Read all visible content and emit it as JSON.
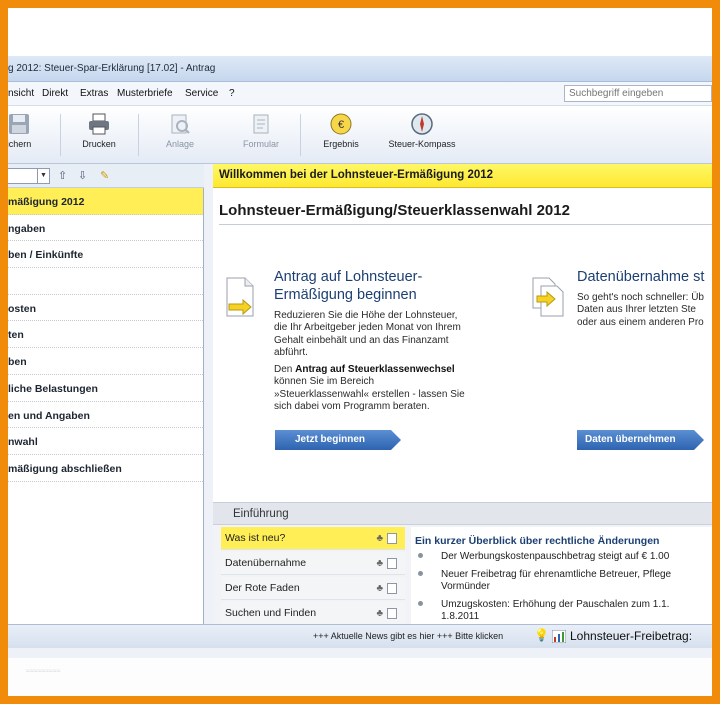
{
  "window": {
    "title": "g 2012: Steuer-Spar-Erklärung [17.02] - Antrag"
  },
  "menu": {
    "items": [
      "nsicht",
      "Direkt",
      "Extras",
      "Musterbriefe",
      "Service",
      "?"
    ],
    "search_placeholder": "Suchbegriff eingeben"
  },
  "toolbar": {
    "save_label": "ichern",
    "print_label": "Drucken",
    "attach_label": "Anlage",
    "form_label": "Formular",
    "result_label": "Ergebnis",
    "compass_label": "Steuer-Kompass"
  },
  "sidebar": {
    "items": [
      "mäßigung 2012",
      "ngaben",
      "ben / Einkünfte",
      "",
      "osten",
      "ten",
      "ben",
      "liche Belastungen",
      "en und Angaben",
      "nwahl",
      "mäßigung abschließen"
    ]
  },
  "main": {
    "welcome": "Willkommen bei der Lohnsteuer-Ermäßigung 2012",
    "page_title": "Lohnsteuer-Ermäßigung/Steuerklassenwahl 2012",
    "card1": {
      "title_line1": "Antrag auf Lohnsteuer-",
      "title_line2": "Ermäßigung beginnen",
      "para1_line1": "Reduzieren Sie die Höhe der Lohnsteuer,",
      "para1_line2": "die Ihr Arbeitgeber jeden Monat von Ihrem",
      "para1_line3": "Gehalt einbehält und an das Finanzamt",
      "para1_line4": "abführt.",
      "para2_pre": "Den ",
      "para2_bold": "Antrag auf Steuerklassenwechsel",
      "para2_line2": "können Sie im Bereich",
      "para2_line3": "»Steuerklassenwahl« erstellen - lassen Sie",
      "para2_line4": "sich dabei vom Programm beraten.",
      "button": "Jetzt beginnen"
    },
    "card2": {
      "title": "Datenübernahme st",
      "line1": "So geht's noch schneller: Üb",
      "line2": "Daten aus Ihrer letzten Ste",
      "line3": "oder aus einem anderen Pro",
      "button": "Daten übernehmen"
    }
  },
  "intro": {
    "header": "Einführung",
    "links": [
      "Was ist neu?",
      "Datenübernahme",
      "Der Rote Faden",
      "Suchen und Finden"
    ],
    "news_title": "Ein kurzer Überblick über rechtliche Änderungen",
    "news": [
      {
        "line1": "Der Werbungskostenpauschbetrag steigt auf € 1.00",
        "line2": ""
      },
      {
        "line1": "Neuer Freibetrag für ehrenamtliche Betreuer, Pflege",
        "line2": "Vormünder"
      },
      {
        "line1": "Umzugskosten: Erhöhung der Pauschalen zum 1.1.",
        "line2": "1.8.2011"
      }
    ]
  },
  "statusbar": {
    "ticker": "+++ Aktuelle News gibt es hier +++ Bitte klicken",
    "freibetrag": "Lohnsteuer-Freibetrag:"
  },
  "colors": {
    "frame": "#f08c0a",
    "highlight": "#ffee55",
    "button": "#3a6fbd",
    "heading": "#1c3f73"
  }
}
